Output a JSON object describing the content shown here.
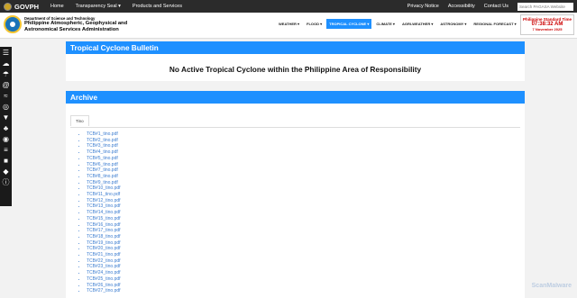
{
  "govbar": {
    "brand": "GOVPH",
    "nav": [
      "Home",
      "Transparency Seal ▾",
      "Products and Services"
    ],
    "right": [
      "Privacy Notice",
      "Accessibility",
      "Contact Us"
    ],
    "search_placeholder": "Search PAGASA Website"
  },
  "header": {
    "dept": "Department of Science and Technology",
    "agency": "Philippine Atmospheric, Geophysical and Astronomical Services Administration"
  },
  "mainnav": [
    "WEATHER ▾",
    "FLOOD ▾",
    "TROPICAL CYCLONE ▾",
    "CLIMATE ▾",
    "AGRI-WEATHER ▾",
    "ASTRONOMY ▾",
    "REGIONAL FORECAST ▾"
  ],
  "clock": {
    "label": "Philippine Standard Time",
    "time": "07:38:32 AM",
    "date": "7 November 2025"
  },
  "sidebar_icons": [
    "menu-icon",
    "cloud-icon",
    "rain-icon",
    "typhoon-icon",
    "flood-icon",
    "planet-icon",
    "tornado-icon",
    "agri-icon",
    "radar-icon",
    "bridge-icon",
    "info-lock-icon",
    "shield-icon",
    "info-icon"
  ],
  "bulletin": {
    "title": "Tropical Cyclone Bulletin",
    "message": "No Active Tropical Cyclone within the Philippine Area of Responsibility"
  },
  "archive": {
    "title": "Archive",
    "tab": "Tino",
    "files": [
      "TCB#1_tino.pdf",
      "TCB#2_tino.pdf",
      "TCB#3_tino.pdf",
      "TCB#4_tino.pdf",
      "TCB#5_tino.pdf",
      "TCB#6_tino.pdf",
      "TCB#7_tino.pdf",
      "TCB#8_tino.pdf",
      "TCB#9_tino.pdf",
      "TCB#10_tino.pdf",
      "TCB#11_tino.pdf",
      "TCB#12_tino.pdf",
      "TCB#13_tino.pdf",
      "TCB#14_tino.pdf",
      "TCB#15_tino.pdf",
      "TCB#16_tino.pdf",
      "TCB#17_tino.pdf",
      "TCB#18_tino.pdf",
      "TCB#19_tino.pdf",
      "TCB#20_tino.pdf",
      "TCB#21_tino.pdf",
      "TCB#22_tino.pdf",
      "TCB#23_tino.pdf",
      "TCB#24_tino.pdf",
      "TCB#25_tino.pdf",
      "TCB#26_tino.pdf",
      "TCB#27_tino.pdf"
    ]
  },
  "watermark": "ScanMalware",
  "colors": {
    "accent": "#1e90ff",
    "clock": "#cc0000",
    "link": "#3c7dd0"
  }
}
